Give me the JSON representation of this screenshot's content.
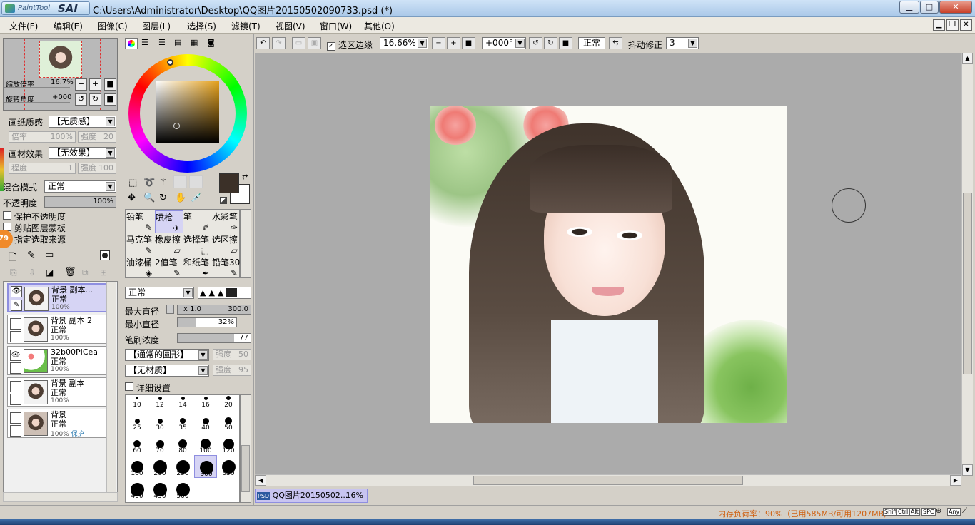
{
  "window": {
    "app_logo_small": "PaintTool",
    "app_logo_big": "SAI",
    "title": "C:\\Users\\Administrator\\Desktop\\QQ图片20150502090733.psd (*)",
    "minimize": "▁",
    "maximize": "□",
    "close": "✕"
  },
  "menu": [
    "文件(F)",
    "编辑(E)",
    "图像(C)",
    "图层(L)",
    "选择(S)",
    "滤镜(T)",
    "视图(V)",
    "窗口(W)",
    "其他(O)"
  ],
  "toolbar": {
    "selection_edge_label": "选区边缘",
    "zoom_value": "16.66%",
    "rotate_value": "+000°",
    "blend_mode": "正常",
    "stabilizer_label": "抖动修正",
    "stabilizer_value": "3"
  },
  "navigator": {
    "zoom_label": "缩放倍率",
    "zoom_value": "16.7%",
    "rotate_label": "旋转角度",
    "rotate_value": "+000"
  },
  "paper": {
    "texture_label": "画纸质感",
    "texture_value": "【无质感】",
    "scale_label": "倍率",
    "scale_value": "100%",
    "strength_label": "强度",
    "strength_value": "20",
    "effect_label": "画材效果",
    "effect_value": "【无效果】",
    "degree_label": "程度",
    "degree_value": "1",
    "effect_strength_label": "强度",
    "effect_strength_value": "100"
  },
  "layer_props": {
    "blend_label": "混合模式",
    "blend_value": "正常",
    "opacity_label": "不透明度",
    "opacity_value": "100%",
    "opacity_level": 1.0,
    "protect_opacity": "保护不透明度",
    "clip_group": "剪贴图层蒙板",
    "sel_source": "指定选取来源",
    "badge": "79"
  },
  "layers": [
    {
      "name": "背景 副本...",
      "mode": "正常",
      "opacity": "100%",
      "visible": true,
      "selected": true,
      "extra": ""
    },
    {
      "name": "背景 副本 2",
      "mode": "正常",
      "opacity": "100%",
      "visible": false,
      "selected": false,
      "extra": ""
    },
    {
      "name": "32b00PICea",
      "mode": "正常",
      "opacity": "100%",
      "visible": true,
      "selected": false,
      "extra": ""
    },
    {
      "name": "背景 副本",
      "mode": "正常",
      "opacity": "100%",
      "visible": false,
      "selected": false,
      "extra": ""
    },
    {
      "name": "背景",
      "mode": "正常",
      "opacity": "100%",
      "visible": false,
      "selected": false,
      "extra": "保护"
    }
  ],
  "tools": [
    [
      "铅笔",
      "喷枪",
      "笔",
      "水彩笔"
    ],
    [
      "马克笔",
      "橡皮擦",
      "选择笔",
      "选区擦"
    ],
    [
      "油漆桶",
      "2值笔",
      "和纸笔",
      "铅笔30"
    ]
  ],
  "brush": {
    "mode": "正常",
    "max_size_label": "最大直径",
    "max_size_mult": "x 1.0",
    "max_size_value": "300.0",
    "min_size_label": "最小直径",
    "min_size_value": "32%",
    "min_size_level": 0.32,
    "density_label": "笔刷浓度",
    "density_value": "77",
    "density_level": 0.77,
    "shape_value": "【通常的圆形】",
    "shape_strength_label": "强度",
    "shape_strength_value": "50",
    "texture_value": "【无材质】",
    "texture_strength_label": "强度",
    "texture_strength_value": "95",
    "advanced_label": "详细设置"
  },
  "brush_sizes": [
    "10",
    "12",
    "14",
    "16",
    "20",
    "25",
    "30",
    "35",
    "40",
    "50",
    "60",
    "70",
    "80",
    "100",
    "120",
    "160",
    "200",
    "250",
    "300",
    "350",
    "400",
    "450",
    "500"
  ],
  "selected_brush_size": "300",
  "doc_tab": {
    "name": "QQ图片20150502...",
    "zoom": "16%",
    "badge": "PSD"
  },
  "status": {
    "memory": "内存负荷率：90%（已用585MB/可用1207MB）",
    "keys": [
      "Shift",
      "Ctrl",
      "Alt",
      "SPC",
      "Any"
    ]
  },
  "colors": {
    "primary": "#3b3028",
    "secondary": "#ffffff"
  }
}
